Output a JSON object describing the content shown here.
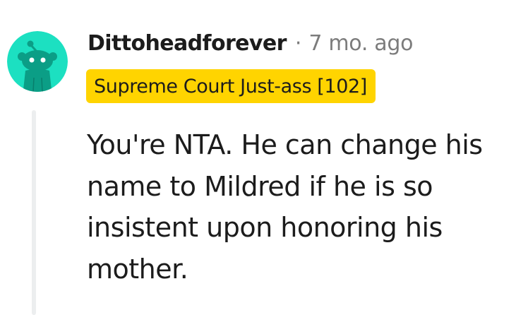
{
  "comment": {
    "username": "Dittoheadforever",
    "separator": "·",
    "timestamp": "7 mo. ago",
    "flair": "Supreme Court Just-ass [102]",
    "body": "You're NTA. He can change his name to Mildred if he is so insistent upon honoring his mother."
  },
  "avatar": {
    "icon": "reddit-snoo-icon",
    "background_color": "#1ce0c1",
    "figure_color": "#0b9e86",
    "eye_color": "#ffffff"
  },
  "colors": {
    "flair_background": "#ffd400",
    "text_primary": "#1c1c1c",
    "text_meta": "#7c7c7c",
    "thread_line": "#eceeef"
  }
}
